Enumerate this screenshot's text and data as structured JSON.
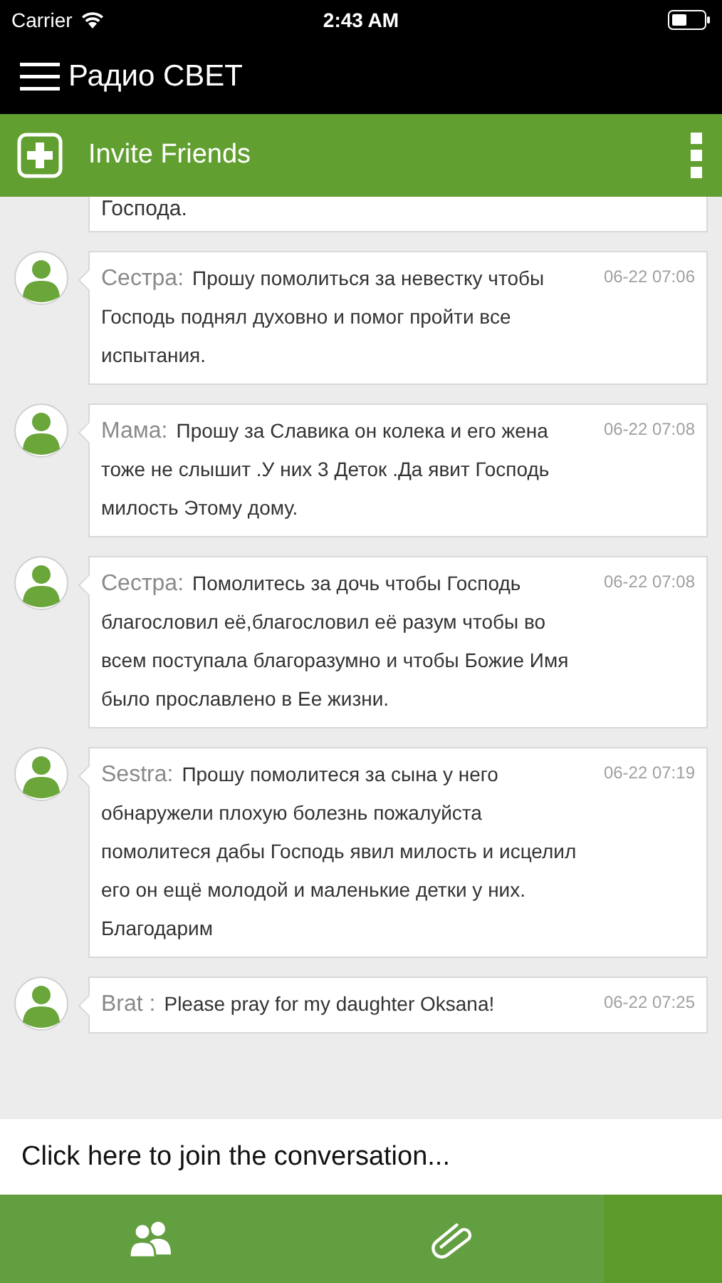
{
  "status_bar": {
    "carrier": "Carrier",
    "time": "2:43 AM"
  },
  "nav_bar": {
    "title": "Радио СВЕТ"
  },
  "action_bar": {
    "title": "Invite Friends"
  },
  "messages": [
    {
      "kind": "partial",
      "text": "Господа."
    },
    {
      "kind": "message",
      "author": "Сестра:",
      "text": "Прошу помолиться за невестку чтобы Господь поднял духовно и помог пройти все испытания.",
      "time": "06-22 07:06"
    },
    {
      "kind": "message",
      "author": "Мама:",
      "text": "Прошу за Славика он колека и его жена тоже не слышит .У них 3 Деток .Да явит Господь милость Этому дому.",
      "time": "06-22 07:08"
    },
    {
      "kind": "message",
      "author": "Сестра:",
      "text": "Помолитесь за дочь чтобы Господь благословил её,благословил её разум чтобы во всем поступала благоразумно и чтобы Божие Имя было прославлено в Ее жизни.",
      "time": "06-22 07:08"
    },
    {
      "kind": "message",
      "author": "Sestra:",
      "text": "Прошу помолитеся за сына у него обнаружели плохую болезнь пожалуйста помолитеся дабы Господь явил милость и исцелил его он ещё молодой и маленькие детки у них. Благодарим",
      "time": "06-22 07:19"
    },
    {
      "kind": "message",
      "author": "Brat :",
      "text": "Please pray for my daughter Oksana!",
      "time": "06-22 07:25"
    }
  ],
  "composer": {
    "placeholder": "Click here to join the conversation..."
  },
  "bottom_tabs": [
    {
      "kind": "people",
      "selected": false
    },
    {
      "kind": "attachment",
      "selected": false
    },
    {
      "kind": "blank",
      "selected": true
    }
  ]
}
